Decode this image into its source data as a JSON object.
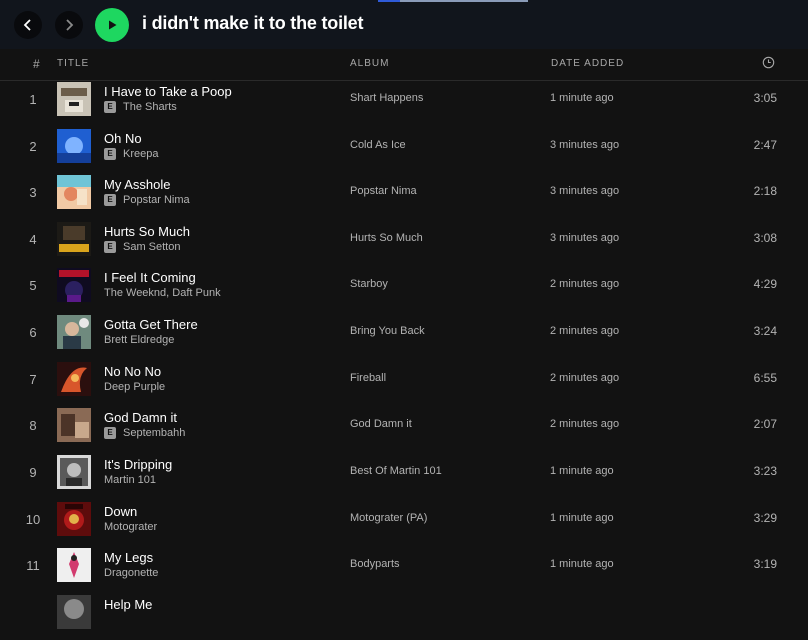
{
  "header": {
    "title": "i didn't make it to the toilet",
    "icons": {
      "back": "chevron-left-icon",
      "forward": "chevron-right-icon",
      "play": "play-icon"
    },
    "accent_color": "#1ed760"
  },
  "columns": {
    "number": "#",
    "title": "TITLE",
    "album": "ALBUM",
    "date_added": "DATE ADDED",
    "duration_icon": "clock-icon"
  },
  "tracks": [
    {
      "num": "1",
      "title": "I Have to Take a Poop",
      "artist": "The Sharts",
      "explicit": true,
      "album": "Shart Happens",
      "date": "1 minute ago",
      "duration": "3:05"
    },
    {
      "num": "2",
      "title": "Oh No",
      "artist": "Kreepa",
      "explicit": true,
      "album": "Cold As Ice",
      "date": "3 minutes ago",
      "duration": "2:47"
    },
    {
      "num": "3",
      "title": "My Asshole",
      "artist": "Popstar Nima",
      "explicit": true,
      "album": "Popstar Nima",
      "date": "3 minutes ago",
      "duration": "2:18"
    },
    {
      "num": "4",
      "title": "Hurts So Much",
      "artist": "Sam Setton",
      "explicit": true,
      "album": "Hurts So Much",
      "date": "3 minutes ago",
      "duration": "3:08"
    },
    {
      "num": "5",
      "title": "I Feel It Coming",
      "artist": "The Weeknd, Daft Punk",
      "explicit": false,
      "album": "Starboy",
      "date": "2 minutes ago",
      "duration": "4:29"
    },
    {
      "num": "6",
      "title": "Gotta Get There",
      "artist": "Brett Eldredge",
      "explicit": false,
      "album": "Bring You Back",
      "date": "2 minutes ago",
      "duration": "3:24"
    },
    {
      "num": "7",
      "title": "No No No",
      "artist": "Deep Purple",
      "explicit": false,
      "album": "Fireball",
      "date": "2 minutes ago",
      "duration": "6:55"
    },
    {
      "num": "8",
      "title": "God Damn it",
      "artist": "Septembahh",
      "explicit": true,
      "album": "God Damn it",
      "date": "2 minutes ago",
      "duration": "2:07"
    },
    {
      "num": "9",
      "title": "It's Dripping",
      "artist": "Martin 101",
      "explicit": false,
      "album": "Best Of Martin 101",
      "date": "1 minute ago",
      "duration": "3:23"
    },
    {
      "num": "10",
      "title": "Down",
      "artist": "Motograter",
      "explicit": false,
      "album": "Motograter (PA)",
      "date": "1 minute ago",
      "duration": "3:29"
    },
    {
      "num": "11",
      "title": "My Legs",
      "artist": "Dragonette",
      "explicit": false,
      "album": "Bodyparts",
      "date": "1 minute ago",
      "duration": "3:19"
    },
    {
      "num": "",
      "title": "Help Me",
      "artist": "",
      "explicit": false,
      "album": "",
      "date": "",
      "duration": ""
    }
  ],
  "explicit_label": "E"
}
